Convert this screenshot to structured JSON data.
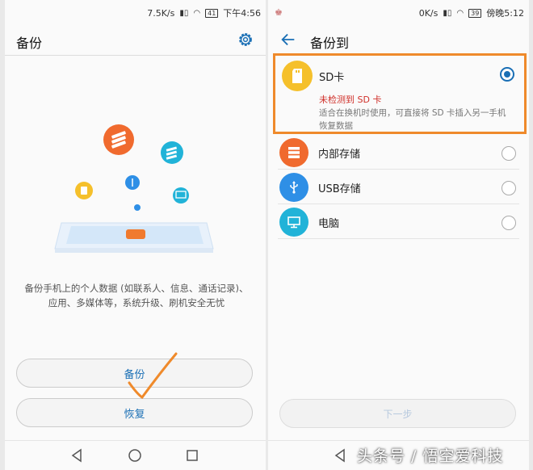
{
  "left_screen": {
    "status": {
      "net_speed": "7.5K/s",
      "battery": "41",
      "time": "下午4:56"
    },
    "title": "备份",
    "description": "备份手机上的个人数据 (如联系人、信息、通话记录)、应用、多媒体等，系统升级、刷机安全无忧",
    "buttons": {
      "backup": "备份",
      "restore": "恢复"
    }
  },
  "right_screen": {
    "status": {
      "net_speed": "0K/s",
      "battery": "39",
      "time": "傍晚5:12"
    },
    "title": "备份到",
    "sd_card": {
      "label": "SD卡",
      "error": "未检测到 SD 卡",
      "hint": "适合在换机时使用，可直接将 SD 卡插入另一手机恢复数据"
    },
    "options": [
      {
        "label": "内部存储",
        "icon": "storage-icon",
        "color": "#f06a2e"
      },
      {
        "label": "USB存储",
        "icon": "usb-icon",
        "color": "#2e8fe6"
      },
      {
        "label": "电脑",
        "icon": "monitor-icon",
        "color": "#21b3d8"
      }
    ],
    "next_button": "下一步"
  },
  "watermark": "头条号 / 悟空爱科技",
  "colors": {
    "accent": "#1a6fb5",
    "highlight_border": "#ef8a2b",
    "error": "#d0302a"
  }
}
